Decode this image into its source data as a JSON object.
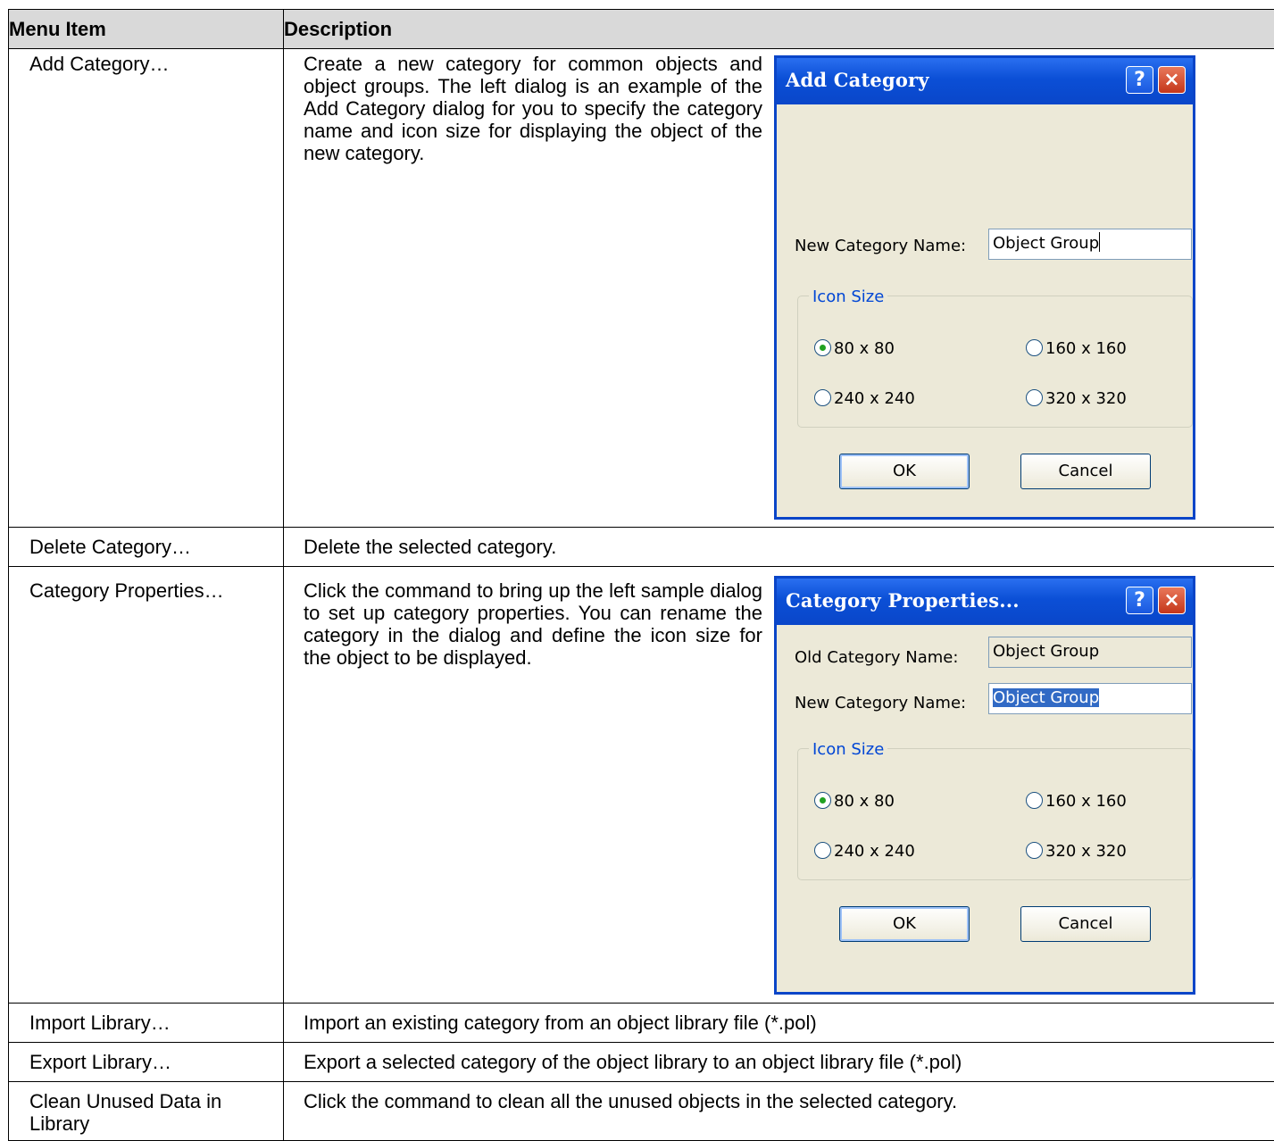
{
  "headers": {
    "menu_item": "Menu Item",
    "description": "Description"
  },
  "rows": [
    {
      "item": "Add Category…",
      "desc": "Create a new category for common objects and object groups. The left dialog is an example of the Add Category dialog for you to specify the category name and icon size for displaying the object of the new category."
    },
    {
      "item": "Delete Category…",
      "desc": "Delete the selected category."
    },
    {
      "item": "Category Properties…",
      "desc": "Click the command to bring up the left sample dialog to set up category properties. You can rename the category in the dialog and define the icon size for the object to be displayed."
    },
    {
      "item": "Import Library…",
      "desc": "Import an existing category from an object library file (*.pol)"
    },
    {
      "item": "Export Library…",
      "desc": "Export a selected category of the object library to an object library file (*.pol)"
    },
    {
      "item": "Clean Unused Data in Library",
      "desc": "Click the command to clean all the unused objects in the selected category."
    }
  ],
  "dialog_add": {
    "title": "Add Category",
    "help": "?",
    "close": "×",
    "new_name_label": "New Category Name:",
    "new_name_value": "Object Group",
    "icon_size_label": "Icon Size",
    "options": [
      "80 x 80",
      "160 x 160",
      "240 x 240",
      "320 x 320"
    ],
    "selected": "80 x 80",
    "ok": "OK",
    "cancel": "Cancel"
  },
  "dialog_props": {
    "title": "Category Properties...",
    "help": "?",
    "close": "×",
    "old_name_label": "Old Category Name:",
    "old_name_value": "Object Group",
    "new_name_label": "New Category Name:",
    "new_name_value": "Object Group",
    "icon_size_label": "Icon Size",
    "options": [
      "80 x 80",
      "160 x 160",
      "240 x 240",
      "320 x 320"
    ],
    "selected": "80 x 80",
    "ok": "OK",
    "cancel": "Cancel"
  }
}
